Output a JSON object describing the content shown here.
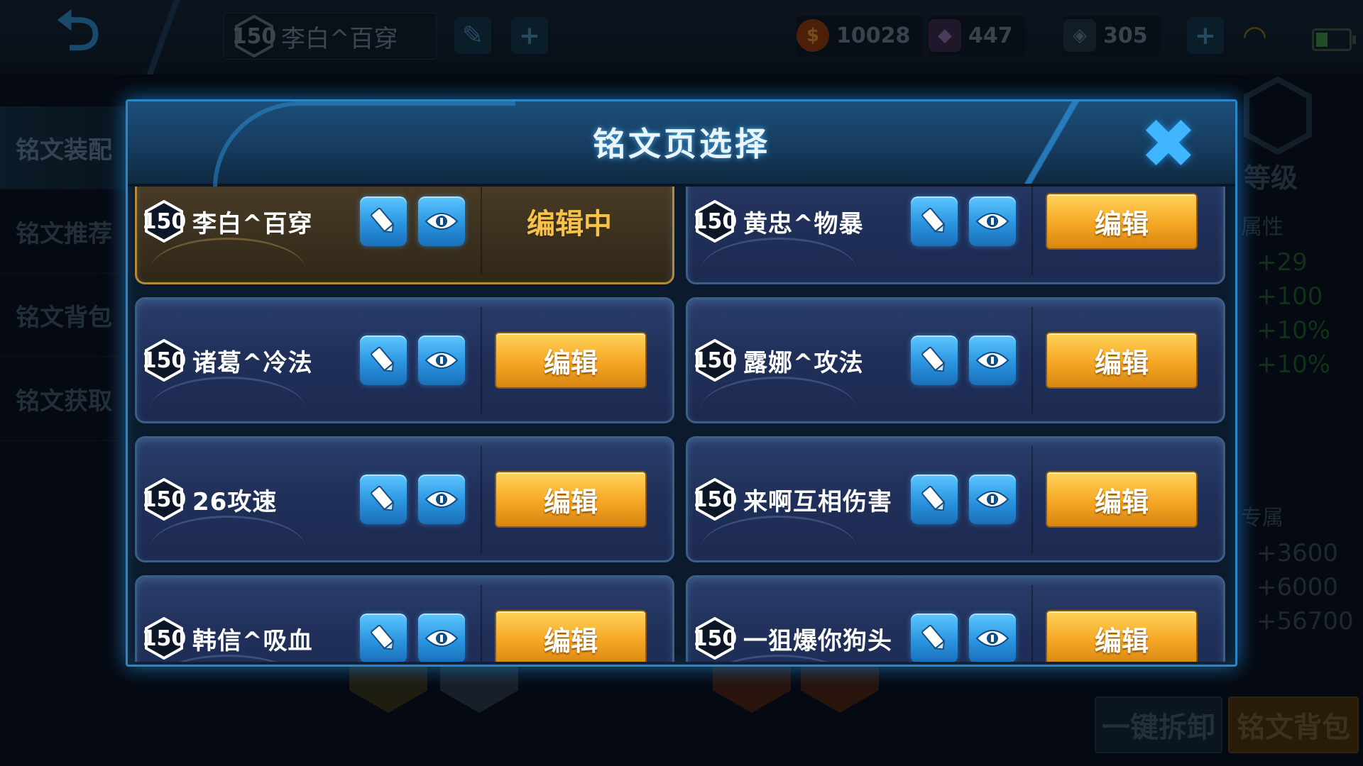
{
  "topbar": {
    "current_page": {
      "level": "150",
      "name": "李白^百穿"
    },
    "currencies": [
      {
        "icon": "gold-coin-icon",
        "value": "10028"
      },
      {
        "icon": "diamond-icon",
        "value": "447"
      },
      {
        "icon": "voucher-icon",
        "value": "305"
      }
    ]
  },
  "sidebar": {
    "items": [
      {
        "label": "铭文装配"
      },
      {
        "label": "铭文推荐"
      },
      {
        "label": "铭文背包"
      },
      {
        "label": "铭文获取"
      }
    ]
  },
  "right_panel": {
    "level_label": "等级",
    "attr_label": "属性",
    "attr_values": [
      "+29",
      "+100",
      "+10%",
      "+10%"
    ],
    "exclusive_label": "专属",
    "exclusive_values": [
      "+3600",
      "+6000",
      "+56700"
    ]
  },
  "bottom": {
    "unload_all": "一键拆卸",
    "inscription_bag": "铭文背包"
  },
  "modal": {
    "title": "铭文页选择",
    "editing_label": "编辑中",
    "edit_label": "编辑",
    "pages": [
      {
        "level": "150",
        "name": "李白^百穿",
        "active": true
      },
      {
        "level": "150",
        "name": "黄忠^物暴",
        "active": false
      },
      {
        "level": "150",
        "name": "诸葛^冷法",
        "active": false
      },
      {
        "level": "150",
        "name": "露娜^攻法",
        "active": false
      },
      {
        "level": "150",
        "name": "26攻速",
        "active": false
      },
      {
        "level": "150",
        "name": "来啊互相伤害",
        "active": false
      },
      {
        "level": "150",
        "name": "韩信^吸血",
        "active": false
      },
      {
        "level": "150",
        "name": "一狙爆你狗头",
        "active": false
      }
    ]
  },
  "colors": {
    "accent_blue": "#2a86c7",
    "edit_orange": "#f5a623",
    "active_gold": "#b58a35"
  }
}
